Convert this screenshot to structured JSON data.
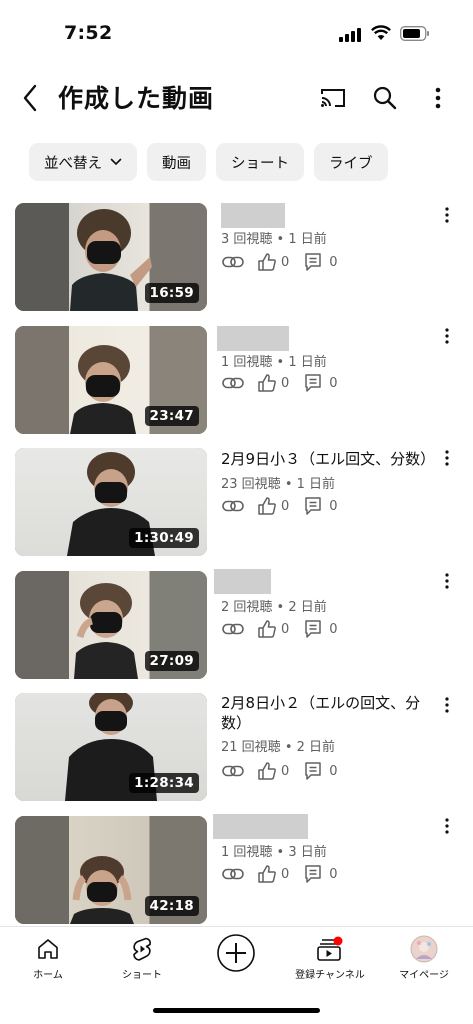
{
  "status_bar": {
    "time": "7:52"
  },
  "header": {
    "title": "作成した動画"
  },
  "chips": [
    {
      "label": "並べ替え",
      "has_dropdown": true
    },
    {
      "label": "動画"
    },
    {
      "label": "ショート"
    },
    {
      "label": "ライブ"
    }
  ],
  "videos": [
    {
      "title": "",
      "title_redacted": true,
      "views": "3 回視聴",
      "age": "1 日前",
      "likes": "0",
      "comments": "0",
      "duration": "16:59"
    },
    {
      "title": "",
      "title_redacted": true,
      "views": "1 回視聴",
      "age": "1 日前",
      "likes": "0",
      "comments": "0",
      "duration": "23:47"
    },
    {
      "title": "2月9日小３（エル回文、分数）",
      "title_redacted": false,
      "views": "23 回視聴",
      "age": "1 日前",
      "likes": "0",
      "comments": "0",
      "duration": "1:30:49"
    },
    {
      "title": "",
      "title_redacted": true,
      "views": "2 回視聴",
      "age": "2 日前",
      "likes": "0",
      "comments": "0",
      "duration": "27:09"
    },
    {
      "title": "2月8日小２（エルの回文、分数）",
      "title_redacted": false,
      "views": "21 回視聴",
      "age": "2 日前",
      "likes": "0",
      "comments": "0",
      "duration": "1:28:34"
    },
    {
      "title": "",
      "title_redacted": true,
      "views": "1 回視聴",
      "age": "3 日前",
      "likes": "0",
      "comments": "0",
      "duration": "42:18"
    }
  ],
  "meta_separator": "•",
  "bottom_nav": {
    "home": "ホーム",
    "shorts": "ショート",
    "subscriptions": "登録チャンネル",
    "you": "マイページ"
  },
  "icons": {
    "back": "chevron-left-icon",
    "cast": "cast-icon",
    "search": "search-icon",
    "more": "more-vert-icon",
    "link": "link-icon",
    "like": "thumb-up-icon",
    "comment": "comment-icon",
    "home": "home-icon",
    "shorts": "shorts-icon",
    "create": "plus-circle-icon",
    "subscriptions": "subscriptions-icon"
  },
  "colors": {
    "text": "#0f0f0f",
    "secondary": "#606060",
    "chip_bg": "#f0f0f0",
    "notification_dot": "#ff0000"
  }
}
